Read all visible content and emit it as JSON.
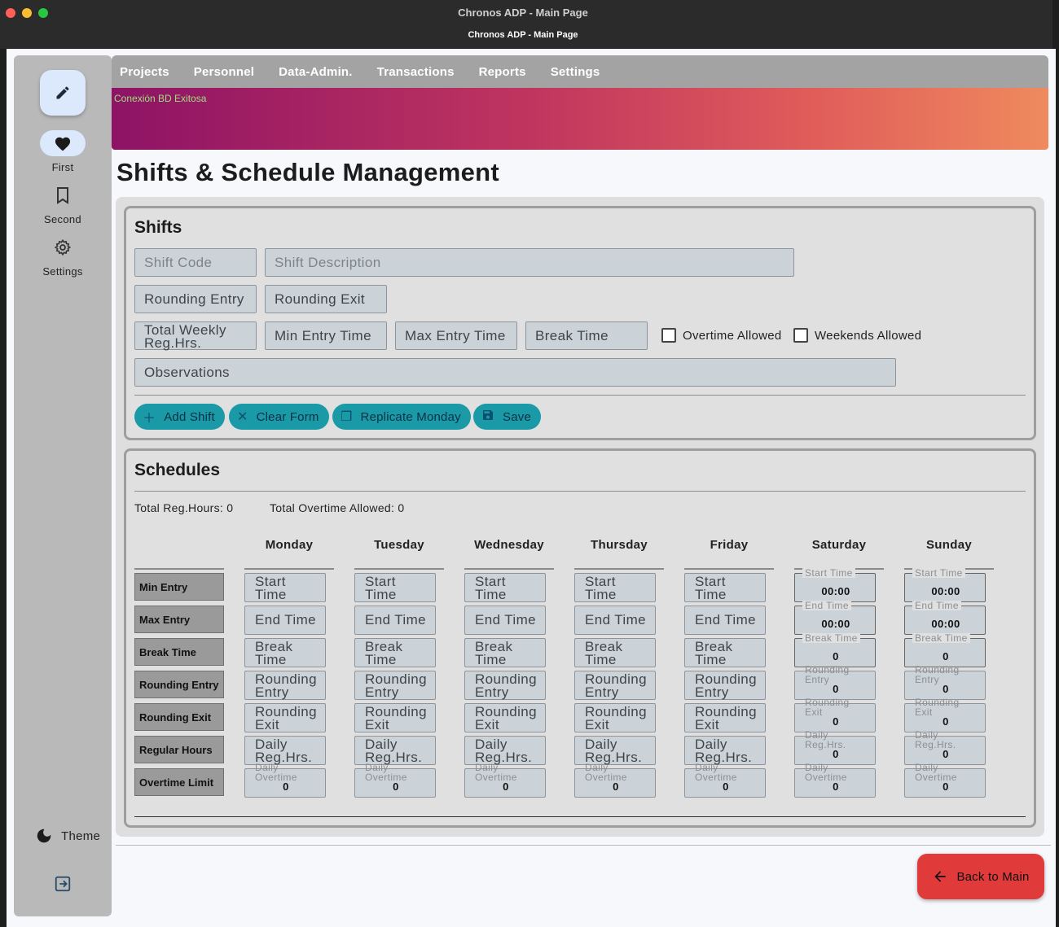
{
  "window": {
    "title": "Chronos ADP - Main Page",
    "subtitle": "Chronos ADP - Main Page"
  },
  "rail": {
    "items": [
      {
        "label": "First",
        "icon": "heart-icon"
      },
      {
        "label": "Second",
        "icon": "bookmark-icon"
      },
      {
        "label": "Settings",
        "icon": "gear-icon"
      }
    ],
    "theme_label": "Theme"
  },
  "nav": [
    "Projects",
    "Personnel",
    "Data-Admin.",
    "Transactions",
    "Reports",
    "Settings"
  ],
  "banner": {
    "status": "Conexión BD Exitosa"
  },
  "page": {
    "title": "Shifts & Schedule Management"
  },
  "shifts": {
    "title": "Shifts",
    "shift_code": "Shift Code",
    "shift_description": "Shift Description",
    "rounding_entry": "Rounding Entry",
    "rounding_exit": "Rounding Exit",
    "total_weekly_1": "Total Weekly",
    "total_weekly_2": "Reg.Hrs.",
    "min_entry_time": "Min Entry Time",
    "max_entry_time": "Max Entry Time",
    "break_time": "Break Time",
    "overtime_allowed": "Overtime Allowed",
    "weekends_allowed": "Weekends Allowed",
    "observations": "Observations",
    "buttons": {
      "add": "Add Shift",
      "clear": "Clear Form",
      "replicate": "Replicate Monday",
      "save": "Save"
    }
  },
  "schedules": {
    "title": "Schedules",
    "total_reg_hours": "Total Reg.Hours: 0",
    "total_overtime": "Total Overtime Allowed: 0",
    "row_labels": [
      "Min Entry",
      "Max Entry",
      "Break Time",
      "Rounding Entry",
      "Rounding Exit",
      "Regular Hours",
      "Overtime Limit"
    ],
    "weekday_fields": {
      "start_1": "Start",
      "start_2": "Time",
      "end": "End Time",
      "break_1": "Break",
      "break_2": "Time",
      "rentry_1": "Rounding",
      "rentry_2": "Entry",
      "rexit_1": "Rounding",
      "rexit_2": "Exit",
      "daily_1": "Daily",
      "daily_2": "Reg.Hrs.",
      "ot_1": "Daily",
      "ot_2": "Overtime",
      "ot_val": "0"
    },
    "weekend_fields": {
      "start_lbl": "Start Time",
      "start_val": "00:00",
      "end_lbl": "End Time",
      "end_val": "00:00",
      "break_lbl": "Break Time",
      "break_val": "0",
      "rentry_1": "Rounding",
      "rentry_2": "Entry",
      "rentry_val": "0",
      "rexit_1": "Rounding",
      "rexit_2": "Exit",
      "rexit_val": "0",
      "daily_1": "Daily",
      "daily_2": "Reg.Hrs.",
      "daily_val": "0",
      "ot_1": "Daily",
      "ot_2": "Overtime",
      "ot_val": "0"
    },
    "days": [
      "Monday",
      "Tuesday",
      "Wednesday",
      "Thursday",
      "Friday",
      "Saturday",
      "Sunday"
    ]
  },
  "footer": {
    "back_label": "Back to Main"
  }
}
